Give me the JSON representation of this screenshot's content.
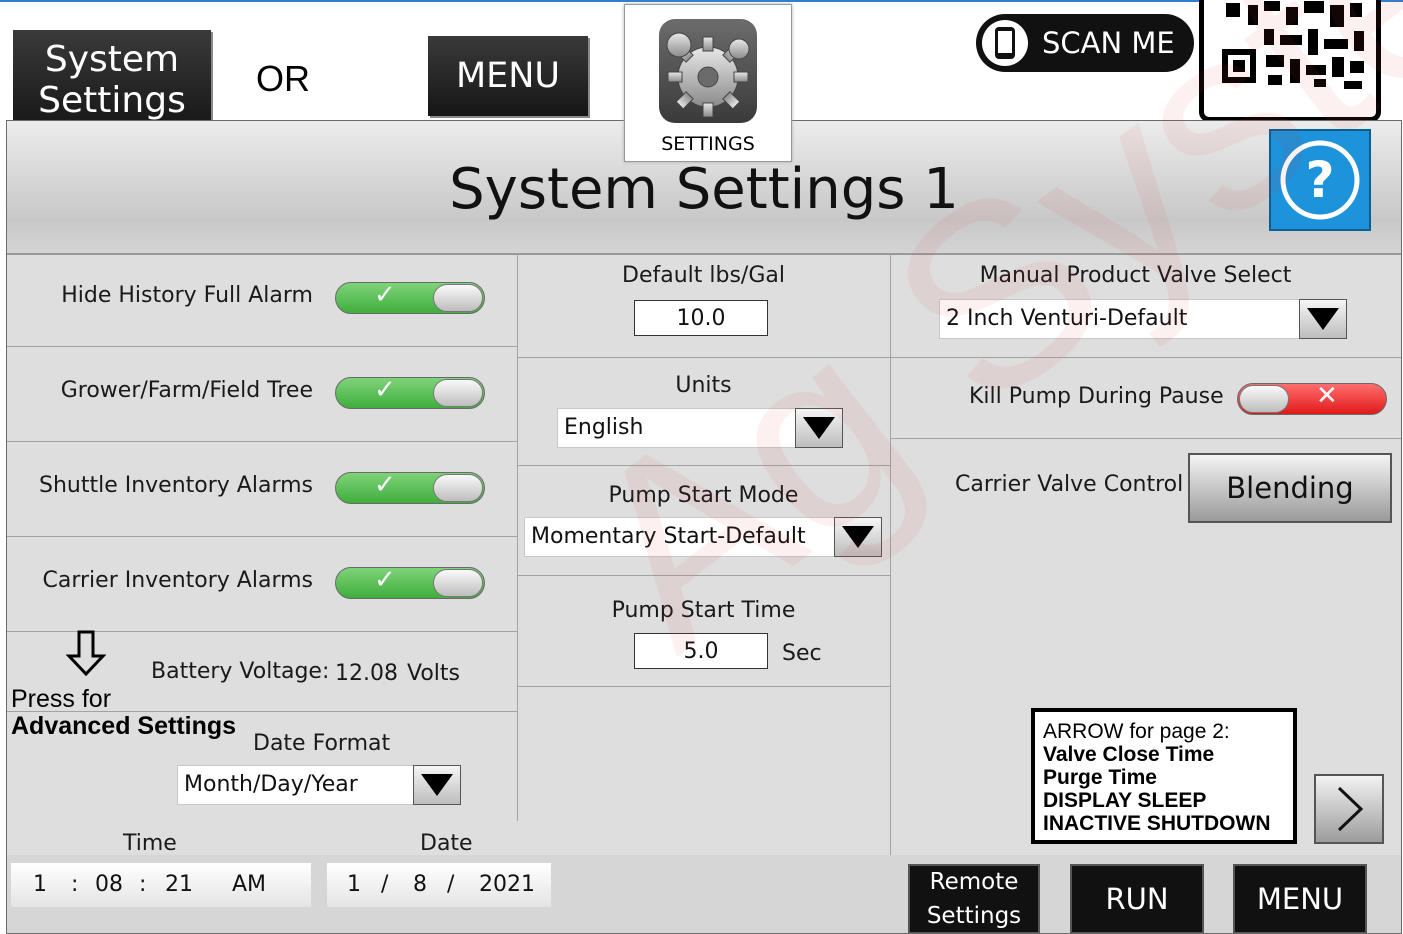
{
  "instruction_strip": {
    "system_settings_button": "System Settings",
    "or_label": "OR",
    "menu_button": "MENU",
    "settings_icon_caption": "SETTINGS",
    "scan_me": "SCAN ME"
  },
  "header": {
    "title": "System Settings 1",
    "help_icon": "question-mark-icon"
  },
  "left_column": {
    "toggles": [
      {
        "label": "Hide History Full Alarm",
        "state": "on"
      },
      {
        "label": "Grower/Farm/Field Tree",
        "state": "on"
      },
      {
        "label": "Shuttle Inventory Alarms",
        "state": "on"
      },
      {
        "label": "Carrier Inventory Alarms",
        "state": "on"
      }
    ],
    "battery_label": "Battery Voltage:",
    "battery_value": "12.08",
    "battery_unit": "Volts",
    "date_format_label": "Date Format",
    "date_format_value": "Month/Day/Year"
  },
  "middle_column": {
    "default_lbs_gal_label": "Default lbs/Gal",
    "default_lbs_gal_value": "10.0",
    "units_label": "Units",
    "units_value": "English",
    "pump_start_mode_label": "Pump Start Mode",
    "pump_start_mode_value": "Momentary Start-Default",
    "pump_start_time_label": "Pump Start Time",
    "pump_start_time_value": "5.0",
    "pump_start_time_unit": "Sec"
  },
  "right_column": {
    "manual_valve_label": "Manual Product Valve Select",
    "manual_valve_value": "2 Inch Venturi-Default",
    "kill_pump_label": "Kill Pump During Pause",
    "kill_pump_state": "off",
    "carrier_valve_label": "Carrier Valve Control",
    "carrier_valve_button": "Blending"
  },
  "annotations": {
    "press_for": "Press for",
    "advanced_settings": "Advanced Settings",
    "arrow_note_intro": "ARROW for page 2:",
    "arrow_note_items": [
      "Valve Close Time",
      "Purge Time",
      "DISPLAY SLEEP",
      "INACTIVE SHUTDOWN"
    ]
  },
  "bottom_bar": {
    "time_label": "Time",
    "date_label": "Date",
    "hour": "1",
    "minute": "08",
    "second": "21",
    "ampm": "AM",
    "month": "1",
    "day": "8",
    "year": "2021",
    "time_sep": ":",
    "date_sep": "/",
    "remote_settings": "Remote Settings",
    "run": "RUN",
    "menu": "MENU"
  },
  "watermark": "Ag Systems",
  "colors": {
    "toggle_on": "#3fae3c",
    "toggle_off": "#e01919",
    "help_blue": "#1c93db"
  }
}
